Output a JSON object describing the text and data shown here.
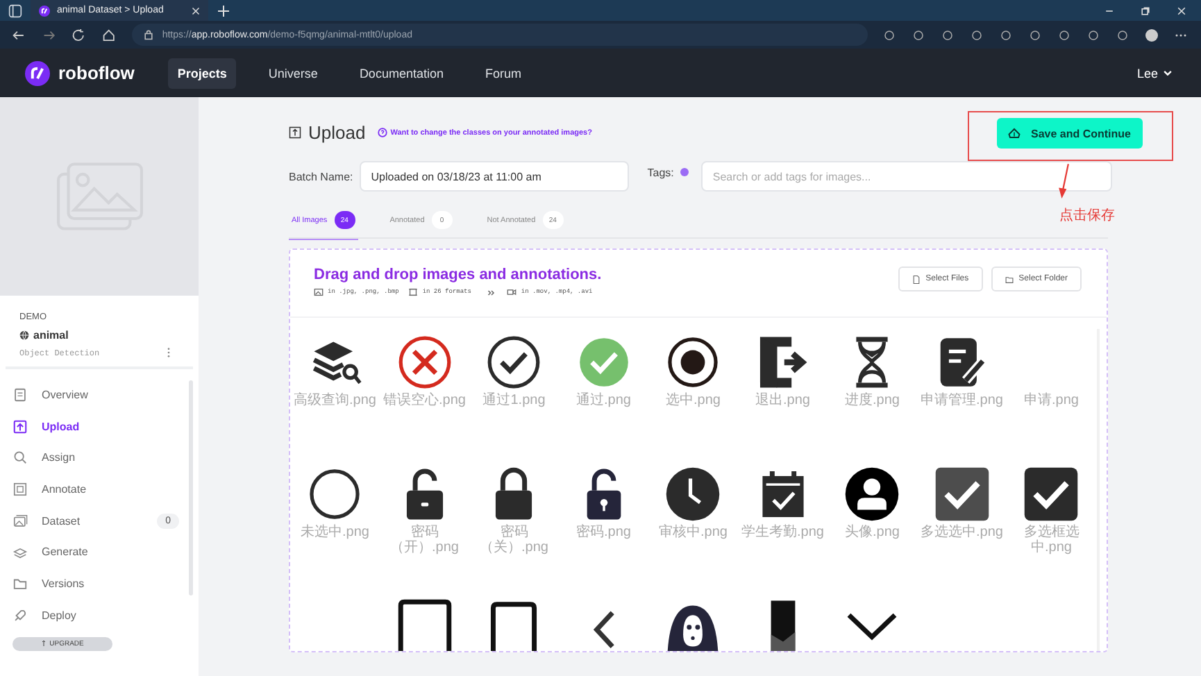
{
  "browser": {
    "tab_title": "animal Dataset > Upload",
    "url_scheme": "https://",
    "url_host": "app.roboflow.com",
    "url_path": "/demo-f5qmg/animal-mtlt0/upload"
  },
  "nav": {
    "brand": "roboflow",
    "items": [
      {
        "label": "Projects",
        "selected": true
      },
      {
        "label": "Universe",
        "selected": false
      },
      {
        "label": "Documentation",
        "selected": false
      },
      {
        "label": "Forum",
        "selected": false
      }
    ],
    "user": "Lee"
  },
  "sidebar": {
    "workspace": "DEMO",
    "project": "animal",
    "project_type": "Object Detection",
    "items": [
      {
        "label": "Overview",
        "kind": "doc",
        "selected": false
      },
      {
        "label": "Upload",
        "kind": "upload",
        "selected": true
      },
      {
        "label": "Assign",
        "kind": "search",
        "selected": false
      },
      {
        "label": "Annotate",
        "kind": "frame",
        "selected": false
      },
      {
        "label": "Dataset",
        "kind": "images",
        "selected": false,
        "count": "0"
      },
      {
        "label": "Generate",
        "kind": "stack",
        "selected": false
      },
      {
        "label": "Versions",
        "kind": "folder",
        "selected": false
      },
      {
        "label": "Deploy",
        "kind": "rocket",
        "selected": false
      }
    ],
    "upgrade": "UPGRADE"
  },
  "upload": {
    "title": "Upload",
    "help_link": "Want to change the classes on your annotated images?",
    "save_button": "Save and Continue",
    "annotation_note": "点击保存",
    "batch_label": "Batch Name:",
    "batch_value": "Uploaded on 03/18/23 at 11:00 am",
    "tags_label": "Tags:",
    "tags_placeholder": "Search or add tags for images...",
    "tabs": [
      {
        "label": "All Images",
        "count": "24",
        "selected": true
      },
      {
        "label": "Annotated",
        "count": "0",
        "selected": false
      },
      {
        "label": "Not Annotated",
        "count": "24",
        "selected": false
      }
    ],
    "dropzone": {
      "title": "Drag and drop images and annotations.",
      "formats": [
        {
          "kind": "image",
          "text": "in .jpg, .png, .bmp"
        },
        {
          "kind": "box",
          "text": "in 26 formats"
        },
        {
          "kind": "video",
          "text": "in .mov, .mp4, .avi"
        }
      ],
      "buttons": [
        {
          "label": "Select Files",
          "kind": "file"
        },
        {
          "label": "Select Folder",
          "kind": "folder"
        }
      ]
    },
    "thumbnails": [
      {
        "kind": "layers-search",
        "name": "高级查询.png"
      },
      {
        "kind": "x-circle",
        "name": "错误空心.png"
      },
      {
        "kind": "check-outline",
        "name": "通过1.png"
      },
      {
        "kind": "check-filled",
        "name": "通过.png"
      },
      {
        "kind": "radio",
        "name": "选中.png"
      },
      {
        "kind": "exit",
        "name": "退出.png"
      },
      {
        "kind": "hourglass",
        "name": "进度.png"
      },
      {
        "kind": "note-edit",
        "name": "申请管理.png"
      },
      {
        "kind": "blank",
        "name": "申请.png"
      },
      {
        "kind": "circle",
        "name": "未选中.png"
      },
      {
        "kind": "unlock",
        "name": "密码（开）.png"
      },
      {
        "kind": "lock",
        "name": "密码（关）.png"
      },
      {
        "kind": "keyhole-unlock",
        "name": "密码.png"
      },
      {
        "kind": "clock",
        "name": "审核中.png"
      },
      {
        "kind": "calendar-check",
        "name": "学生考勤.png"
      },
      {
        "kind": "user-circle",
        "name": "头像.png"
      },
      {
        "kind": "check-square-gray",
        "name": "多选选中.png"
      },
      {
        "kind": "check-square-dark",
        "name": "多选框选中.png"
      },
      {
        "kind": "spacer"
      },
      {
        "kind": "bracket"
      },
      {
        "kind": "bracket-small"
      },
      {
        "kind": "chevron-left"
      },
      {
        "kind": "mask"
      },
      {
        "kind": "dark-strip"
      },
      {
        "kind": "chevron-down"
      }
    ]
  }
}
